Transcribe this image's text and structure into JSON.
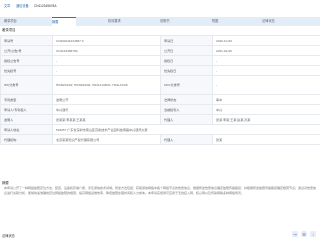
{
  "breadcrumb": {
    "item1": "文章",
    "item2": "通信设备",
    "item3": "CN112345678A"
  },
  "tabs": [
    "著录项目",
    "摘要",
    "权利要求",
    "说明书",
    "附图",
    "法律状态"
  ],
  "section_title": "著录项目",
  "fields": {
    "r1": {
      "k1": "申请号",
      "v1": "CN202011234567.0",
      "k2": "申请日",
      "v2": "2020-10-09"
    },
    "r2": {
      "k1": "公开(公告)号",
      "v1": "CN112345678A",
      "k2": "公开日",
      "v2": "2021-02-05"
    },
    "r3": {
      "k1": "授权公告号",
      "v1": "-",
      "k2": "授权日",
      "v2": "-"
    },
    "r4": {
      "k1": "优先权号",
      "v1": "-",
      "k2": "优先权日",
      "v2": "-"
    },
    "r5": {
      "k1": "IPC分类号",
      "v1": "H04W24/02; H04W24/04; H04L41/0631; H04L41/06",
      "k2": "CPC分类号",
      "v2": "-"
    },
    "r6": {
      "k1": "专利类型",
      "v1": "发明公开",
      "k2": "法律状态",
      "v2": "审中"
    },
    "r7": {
      "k1": "申请人/专利权人",
      "v1": "中兴通讯",
      "k2": "当前权利人",
      "v2": "中兴"
    },
    "r8": {
      "k1": "发明人",
      "v1": "张某某;李某某;王某某",
      "k2": "代理人",
      "v2": "张某;李某;王某;赵某;孙某"
    },
    "r9": {
      "k1": "申请人地址",
      "v1": "518057 广东省深圳市南山区高新技术产业园科技南路中兴通讯大厦",
      "k2": "",
      "v2": ""
    },
    "r10": {
      "k1": "代理机构",
      "v1": "北京某某知识产权代理有限公司",
      "k2": "代理人",
      "v2": "张某"
    }
  },
  "abstract_title": "摘要",
  "abstract_text": "本申请公开了一种网络故障定位方法、装置、设备和存储介质，涉及通信技术领域。所述方法包括：获取通信网络中各个网络节点的告警信息，根据所述告警信息确定故障传播路径，并根据所述故障传播路径确定根因节点；通过对告警信息进行关联分析，能够快速准确地定位网络故障的根因，提高网络运维效率，降低故障处理时间和人力成本。本申请实施例可应用于无线接入网、核心网以及传输网等多种网络场景。",
  "footer_title": "法律状态",
  "footer_icons": [
    "share-icon",
    "doc-icon",
    "save-icon"
  ]
}
